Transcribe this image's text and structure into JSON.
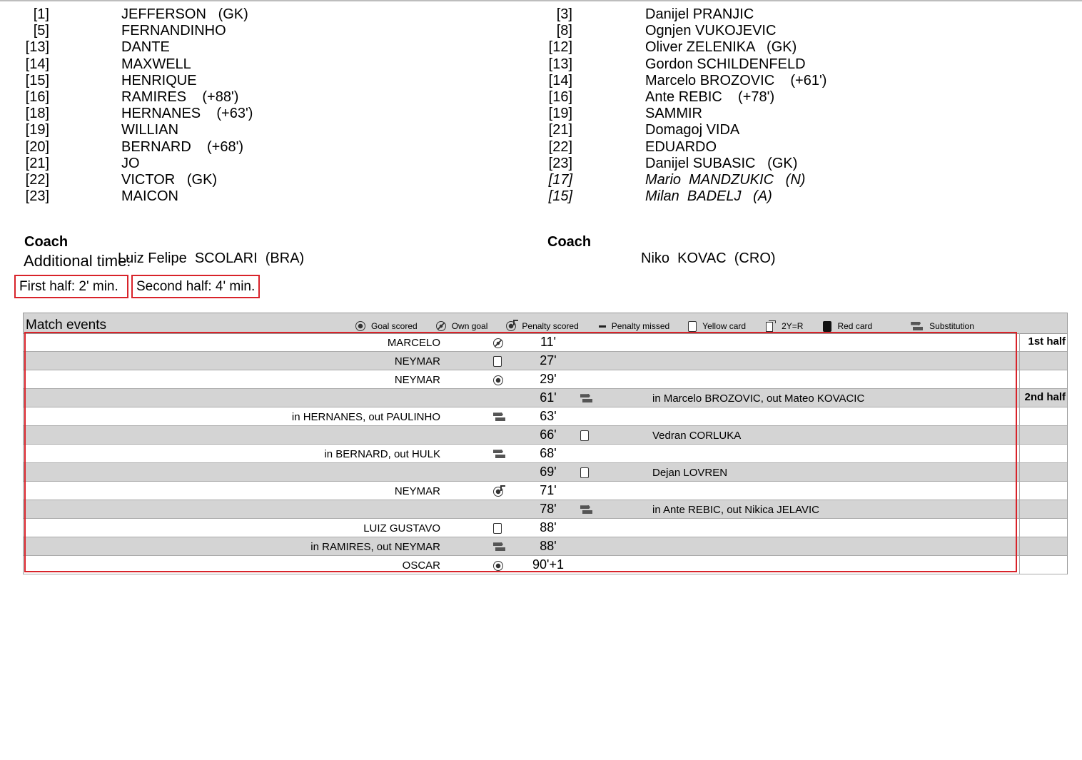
{
  "left_team": {
    "substitutes": [
      {
        "num": "[1]",
        "name": "JEFFERSON   (GK)"
      },
      {
        "num": "[5]",
        "name": "FERNANDINHO"
      },
      {
        "num": "[13]",
        "name": "DANTE"
      },
      {
        "num": "[14]",
        "name": "MAXWELL"
      },
      {
        "num": "[15]",
        "name": "HENRIQUE"
      },
      {
        "num": "[16]",
        "name": "RAMIRES    (+88')"
      },
      {
        "num": "[18]",
        "name": "HERNANES    (+63')"
      },
      {
        "num": "[19]",
        "name": "WILLIAN"
      },
      {
        "num": "[20]",
        "name": "BERNARD    (+68')"
      },
      {
        "num": "[21]",
        "name": "JO"
      },
      {
        "num": "[22]",
        "name": "VICTOR   (GK)"
      },
      {
        "num": "[23]",
        "name": "MAICON"
      }
    ],
    "coach_label": "Coach",
    "coach_name": "Luiz Felipe  SCOLARI  (BRA)"
  },
  "right_team": {
    "substitutes": [
      {
        "num": "[3]",
        "name": "Danijel PRANJIC",
        "italic": false
      },
      {
        "num": "[8]",
        "name": "Ognjen VUKOJEVIC",
        "italic": false
      },
      {
        "num": "[12]",
        "name": "Oliver ZELENIKA   (GK)",
        "italic": false
      },
      {
        "num": "[13]",
        "name": "Gordon SCHILDENFELD",
        "italic": false
      },
      {
        "num": "[14]",
        "name": "Marcelo BROZOVIC    (+61')",
        "italic": false
      },
      {
        "num": "[16]",
        "name": "Ante REBIC    (+78')",
        "italic": false
      },
      {
        "num": "[19]",
        "name": "SAMMIR",
        "italic": false
      },
      {
        "num": "[21]",
        "name": "Domagoj VIDA",
        "italic": false
      },
      {
        "num": "[22]",
        "name": "EDUARDO",
        "italic": false
      },
      {
        "num": "[23]",
        "name": "Danijel SUBASIC   (GK)",
        "italic": false
      },
      {
        "num": "[17]",
        "name": "Mario  MANDZUKIC   (N)",
        "italic": true
      },
      {
        "num": "[15]",
        "name": "Milan  BADELJ   (A)",
        "italic": true
      }
    ],
    "coach_label": "Coach",
    "coach_name": "Niko  KOVAC  (CRO)"
  },
  "additional_time": {
    "title": "Additional time:",
    "first_half": "First half: 2' min.",
    "second_half": "Second half: 4' min."
  },
  "match_events": {
    "title": "Match events",
    "legend": [
      {
        "icon": "goal-scored-icon",
        "label": "Goal scored"
      },
      {
        "icon": "own-goal-icon",
        "label": "Own goal"
      },
      {
        "icon": "penalty-scored-icon",
        "label": "Penalty scored"
      },
      {
        "icon": "penalty-missed-icon",
        "label": "Penalty missed"
      },
      {
        "icon": "yellow-card-icon",
        "label": "Yellow card"
      },
      {
        "icon": "second-yellow-red-icon",
        "label": "2Y=R"
      },
      {
        "icon": "red-card-icon",
        "label": "Red card"
      },
      {
        "icon": "substitution-icon",
        "label": "Substitution"
      }
    ],
    "rows": [
      {
        "left": "MARCELO",
        "left_icon": "own-goal-icon",
        "minute": "11'",
        "right_icon": "",
        "right": "",
        "half": "1st half"
      },
      {
        "left": "NEYMAR",
        "left_icon": "yellow-card-icon",
        "minute": "27'",
        "right_icon": "",
        "right": "",
        "half": ""
      },
      {
        "left": "NEYMAR",
        "left_icon": "goal-scored-icon",
        "minute": "29'",
        "right_icon": "",
        "right": "",
        "half": ""
      },
      {
        "left": "",
        "left_icon": "",
        "minute": "61'",
        "right_icon": "substitution-icon",
        "right": "in Marcelo BROZOVIC, out Mateo KOVACIC",
        "half": "2nd half"
      },
      {
        "left": "in HERNANES, out PAULINHO",
        "left_icon": "substitution-icon",
        "minute": "63'",
        "right_icon": "",
        "right": "",
        "half": ""
      },
      {
        "left": "",
        "left_icon": "",
        "minute": "66'",
        "right_icon": "yellow-card-icon",
        "right": "Vedran CORLUKA",
        "half": ""
      },
      {
        "left": "in BERNARD, out HULK",
        "left_icon": "substitution-icon",
        "minute": "68'",
        "right_icon": "",
        "right": "",
        "half": ""
      },
      {
        "left": "",
        "left_icon": "",
        "minute": "69'",
        "right_icon": "yellow-card-icon",
        "right": "Dejan LOVREN",
        "half": ""
      },
      {
        "left": "NEYMAR",
        "left_icon": "penalty-scored-icon",
        "minute": "71'",
        "right_icon": "",
        "right": "",
        "half": ""
      },
      {
        "left": "",
        "left_icon": "",
        "minute": "78'",
        "right_icon": "substitution-icon",
        "right": "in Ante REBIC, out Nikica JELAVIC",
        "half": ""
      },
      {
        "left": "LUIZ GUSTAVO",
        "left_icon": "yellow-card-icon",
        "minute": "88'",
        "right_icon": "",
        "right": "",
        "half": ""
      },
      {
        "left": "in RAMIRES, out NEYMAR",
        "left_icon": "substitution-icon",
        "minute": "88'",
        "right_icon": "",
        "right": "",
        "half": ""
      },
      {
        "left": "OSCAR",
        "left_icon": "goal-scored-icon",
        "minute": "90'+1",
        "right_icon": "",
        "right": "",
        "half": ""
      }
    ]
  },
  "colors": {
    "highlight_border": "#d8232a",
    "row_shade": "#d4d4d4"
  }
}
